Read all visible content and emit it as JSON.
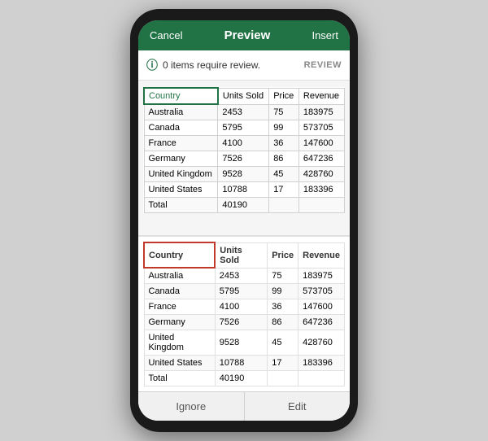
{
  "header": {
    "cancel_label": "Cancel",
    "title": "Preview",
    "insert_label": "Insert"
  },
  "review_banner": {
    "text": "0 items require review.",
    "link_label": "REVIEW"
  },
  "preview_table": {
    "columns": [
      "Country",
      "Units Sold",
      "Price",
      "Revenue"
    ],
    "rows": [
      [
        "Australia",
        "2453",
        "75",
        "183975"
      ],
      [
        "Canada",
        "5795",
        "99",
        "573705"
      ],
      [
        "France",
        "4100",
        "36",
        "147600"
      ],
      [
        "Germany",
        "7526",
        "86",
        "647236"
      ],
      [
        "United Kingdom",
        "9528",
        "45",
        "428760"
      ],
      [
        "United States",
        "10788",
        "17",
        "183396"
      ],
      [
        "Total",
        "40190",
        "",
        ""
      ]
    ]
  },
  "comparison_table": {
    "columns": [
      "Country",
      "Units Sold",
      "Price",
      "Revenue"
    ],
    "rows": [
      [
        "Australia",
        "2453",
        "75",
        "183975"
      ],
      [
        "Canada",
        "5795",
        "99",
        "573705"
      ],
      [
        "France",
        "4100",
        "36",
        "147600"
      ],
      [
        "Germany",
        "7526",
        "86",
        "647236"
      ],
      [
        "United Kingdom",
        "9528",
        "45",
        "428760"
      ],
      [
        "United States",
        "10788",
        "17",
        "183396"
      ],
      [
        "Total",
        "40190",
        "",
        ""
      ]
    ]
  },
  "actions": {
    "ignore_label": "Ignore",
    "edit_label": "Edit"
  }
}
